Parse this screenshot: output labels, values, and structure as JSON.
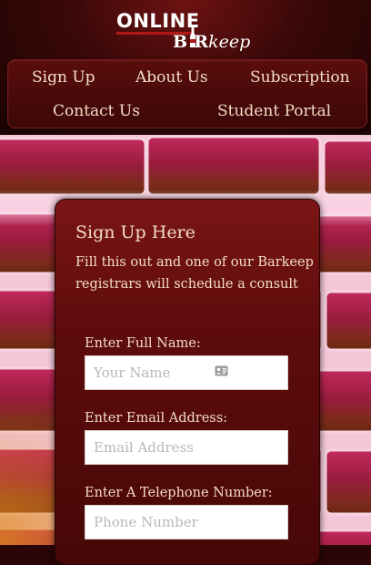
{
  "logo": {
    "top": "ONLINE",
    "bottom_pre": "B",
    "bottom_i": "i",
    "bottom_r": "R",
    "bottom_post": "keep"
  },
  "nav": {
    "signup": "Sign Up",
    "about": "About Us",
    "subscription": "Subscription",
    "contact": "Contact Us",
    "portal": "Student Portal"
  },
  "form": {
    "title": "Sign Up Here",
    "description": "Fill this out and one of our Barkeep registrars will schedule a consult",
    "name_label": "Enter Full Name:",
    "name_placeholder": "Your Name",
    "email_label": "Enter Email Address:",
    "email_placeholder": "Email Address",
    "phone_label": "Enter A Telephone Number:",
    "phone_placeholder": "Phone Number"
  },
  "icons": {
    "contact_card": "contact-card-icon",
    "bottle": "bottle-icon"
  },
  "colors": {
    "header_bg": "#3a0808",
    "card_bg": "#5e0c0c",
    "text": "#f3ddc4",
    "brick": "#a8204a"
  }
}
